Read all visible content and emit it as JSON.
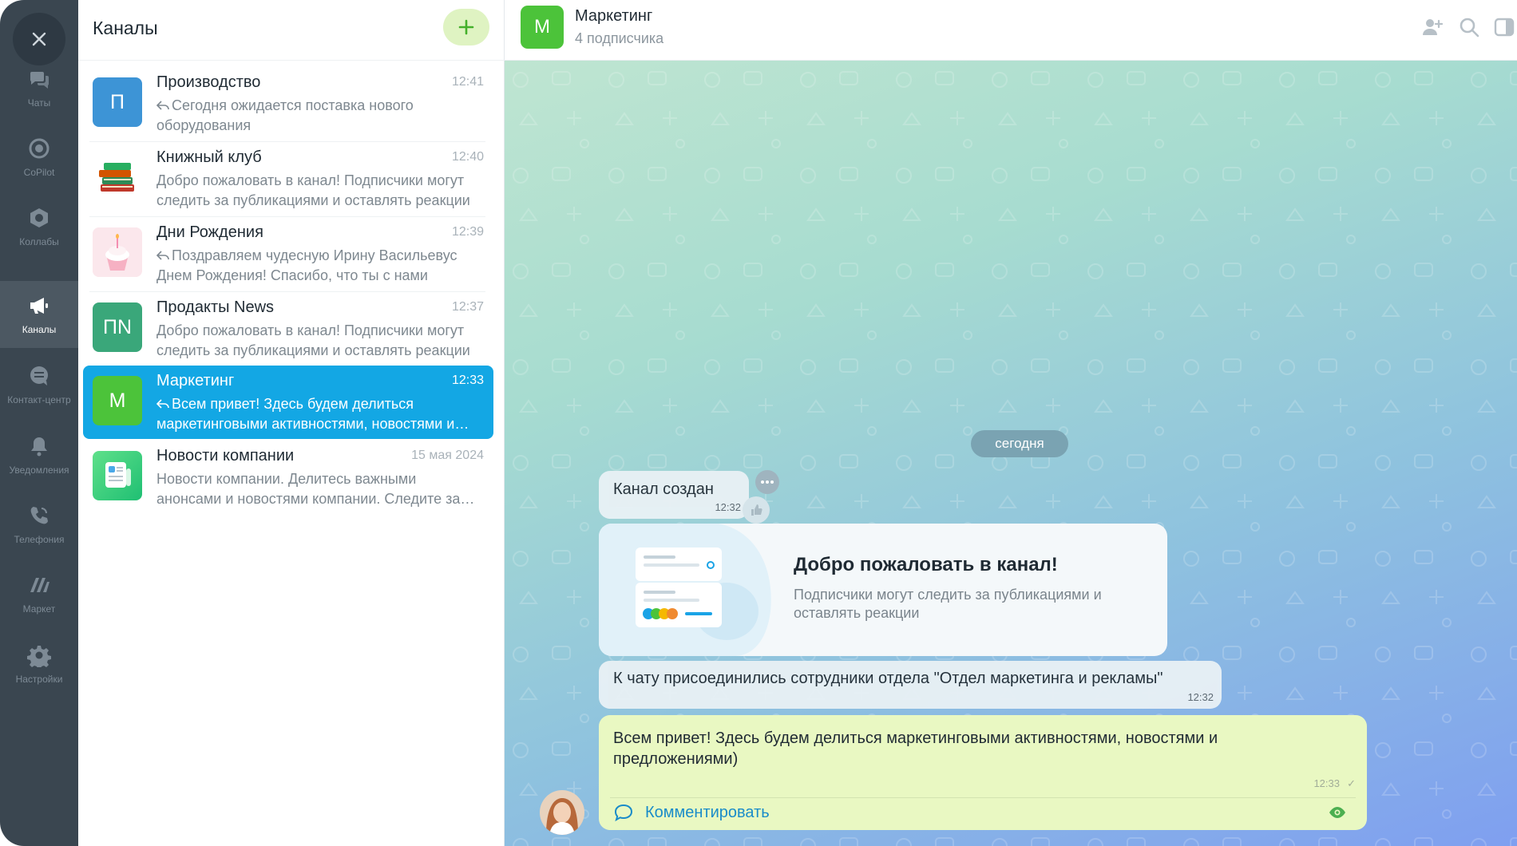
{
  "colors": {
    "rail_bg": "#3a4650",
    "accent_blue": "#13a7e4",
    "brand_green": "#4cc33a",
    "message_bg": "#e9f8c2",
    "link_blue": "#1a8cc9"
  },
  "nav": {
    "close_icon": "close-icon",
    "items": [
      {
        "label": "Чаты",
        "icon": "chats-icon"
      },
      {
        "label": "CoPilot",
        "icon": "copilot-icon"
      },
      {
        "label": "Коллабы",
        "icon": "collabs-icon"
      },
      {
        "label": "Каналы",
        "icon": "megaphone-icon",
        "active": true
      },
      {
        "label": "Контакт-центр",
        "icon": "contact-center-icon"
      },
      {
        "label": "Уведомления",
        "icon": "bell-icon"
      },
      {
        "label": "Телефония",
        "icon": "phone-icon"
      },
      {
        "label": "Маркет",
        "icon": "market-icon"
      },
      {
        "label": "Настройки",
        "icon": "gear-icon"
      }
    ]
  },
  "channels_panel": {
    "title": "Каналы",
    "add_icon": "plus-icon",
    "items": [
      {
        "name": "Производство",
        "time": "12:41",
        "avatar_text": "П",
        "avatar_color": "#3d94d6",
        "reply": true,
        "preview": "Сегодня ожидается поставка нового оборудования"
      },
      {
        "name": "Книжный клуб",
        "time": "12:40",
        "avatar_text": "",
        "avatar_icon": "books-image",
        "reply": false,
        "preview": "Добро пожаловать в канал! Подписчики могут следить за публикациями и оставлять реакции"
      },
      {
        "name": "Дни Рождения",
        "time": "12:39",
        "avatar_text": "",
        "avatar_icon": "cupcake-image",
        "reply": true,
        "preview": "Поздравляем чудесную Ирину Васильевус Днем Рождения! Спасибо, что ты с нами"
      },
      {
        "name": "Продакты News",
        "time": "12:37",
        "avatar_text": "ПN",
        "avatar_color": "#3aa77a",
        "reply": false,
        "preview": "Добро пожаловать в канал! Подписчики могут следить за публикациями и оставлять реакции"
      },
      {
        "name": "Маркетинг",
        "time": "12:33",
        "avatar_text": "М",
        "avatar_color": "#4cc33a",
        "reply": true,
        "active": true,
        "preview": "Всем привет! Здесь будем делиться маркетинговыми активностями, новостями и предложениями)"
      },
      {
        "name": "Новости компании",
        "time": "15 мая 2024",
        "avatar_text": "",
        "avatar_icon": "newspaper-icon",
        "reply": false,
        "preview": "Новости компании. Делитесь важными анонсами и новостями компании. Следите за обновлениями"
      }
    ]
  },
  "chat": {
    "title": "Маркетинг",
    "subtitle": "4 подписчика",
    "avatar_text": "М",
    "header_icons": [
      "add-user-icon",
      "search-icon",
      "sidebar-toggle-icon"
    ],
    "date_divider": "сегодня",
    "system_created": {
      "text": "Канал создан",
      "time": "12:32"
    },
    "welcome": {
      "title": "Добро пожаловать в канал!",
      "text": "Подписчики могут следить за публикациями и оставлять реакции"
    },
    "system_joined": {
      "text": "К чату присоединились сотрудники отдела \"Отдел маркетинга и рекламы\"",
      "time": "12:32"
    },
    "message": {
      "text": "Всем привет! Здесь будем делиться маркетинговыми активностями, новостями и предложениями)",
      "time": "12:33",
      "comment_label": "Комментировать"
    }
  }
}
